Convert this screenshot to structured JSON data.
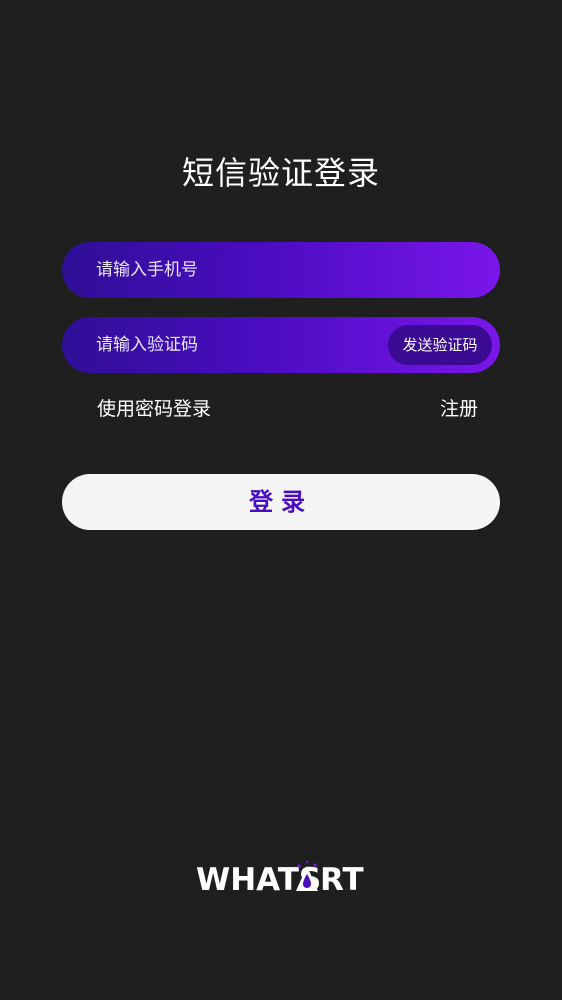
{
  "page": {
    "title": "短信验证登录"
  },
  "form": {
    "phone_placeholder": "请输入手机号",
    "code_placeholder": "请输入验证码",
    "send_code_label": "发送验证码",
    "password_login_label": "使用密码登录",
    "register_label": "注册",
    "login_label": "登录"
  },
  "brand": {
    "logo_text": "WHATSART",
    "accent": "#4a0cc0"
  }
}
